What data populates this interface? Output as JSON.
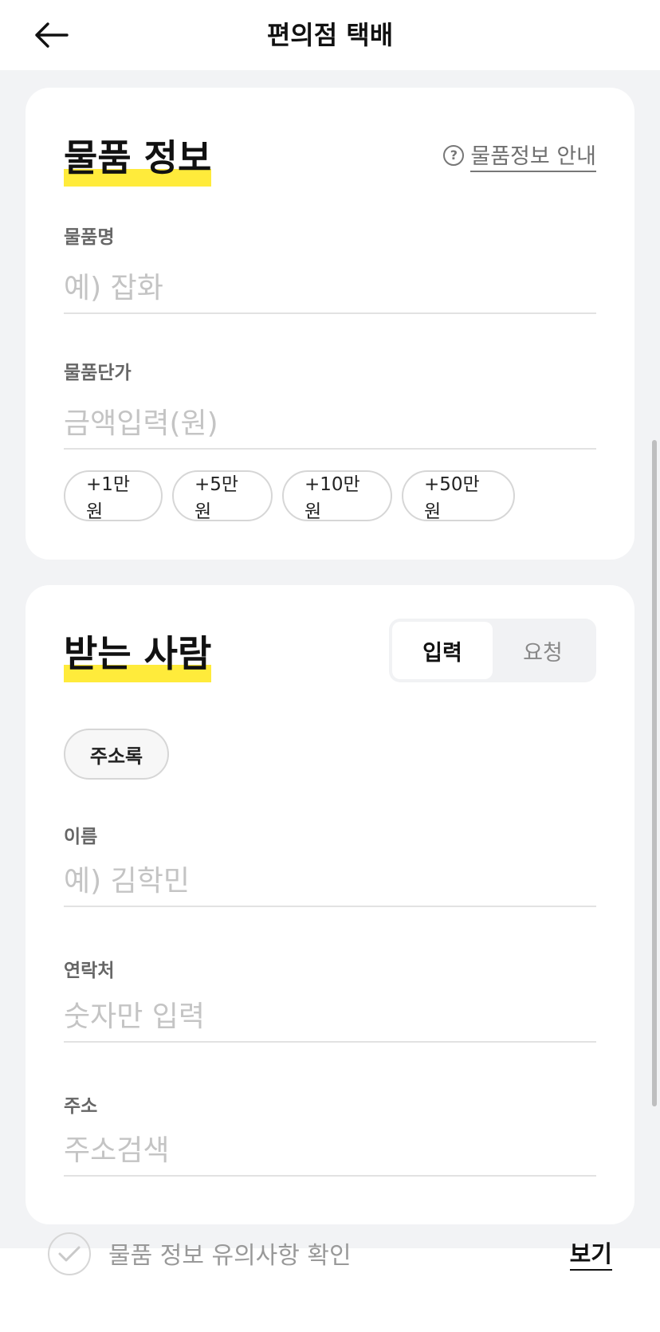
{
  "header": {
    "title": "편의점 택배"
  },
  "item_info": {
    "title": "물품 정보",
    "guide_link": "물품정보 안내",
    "name_label": "물품명",
    "name_placeholder": "예) 잡화",
    "price_label": "물품단가",
    "price_placeholder": "금액입력(원)",
    "chips": [
      "+1만원",
      "+5만원",
      "+10만원",
      "+50만원"
    ]
  },
  "recipient": {
    "title": "받는 사람",
    "segments": {
      "input": "입력",
      "request": "요청",
      "selected": "입력"
    },
    "address_book": "주소록",
    "name_label": "이름",
    "name_placeholder": "예) 김학민",
    "phone_label": "연락처",
    "phone_placeholder": "숫자만 입력",
    "address_label": "주소",
    "address_placeholder": "주소검색"
  },
  "bottom": {
    "check_text": "물품 정보 유의사항 확인",
    "view_link": "보기"
  },
  "colors": {
    "highlight": "#ffeb3b",
    "background": "#f2f3f5"
  }
}
